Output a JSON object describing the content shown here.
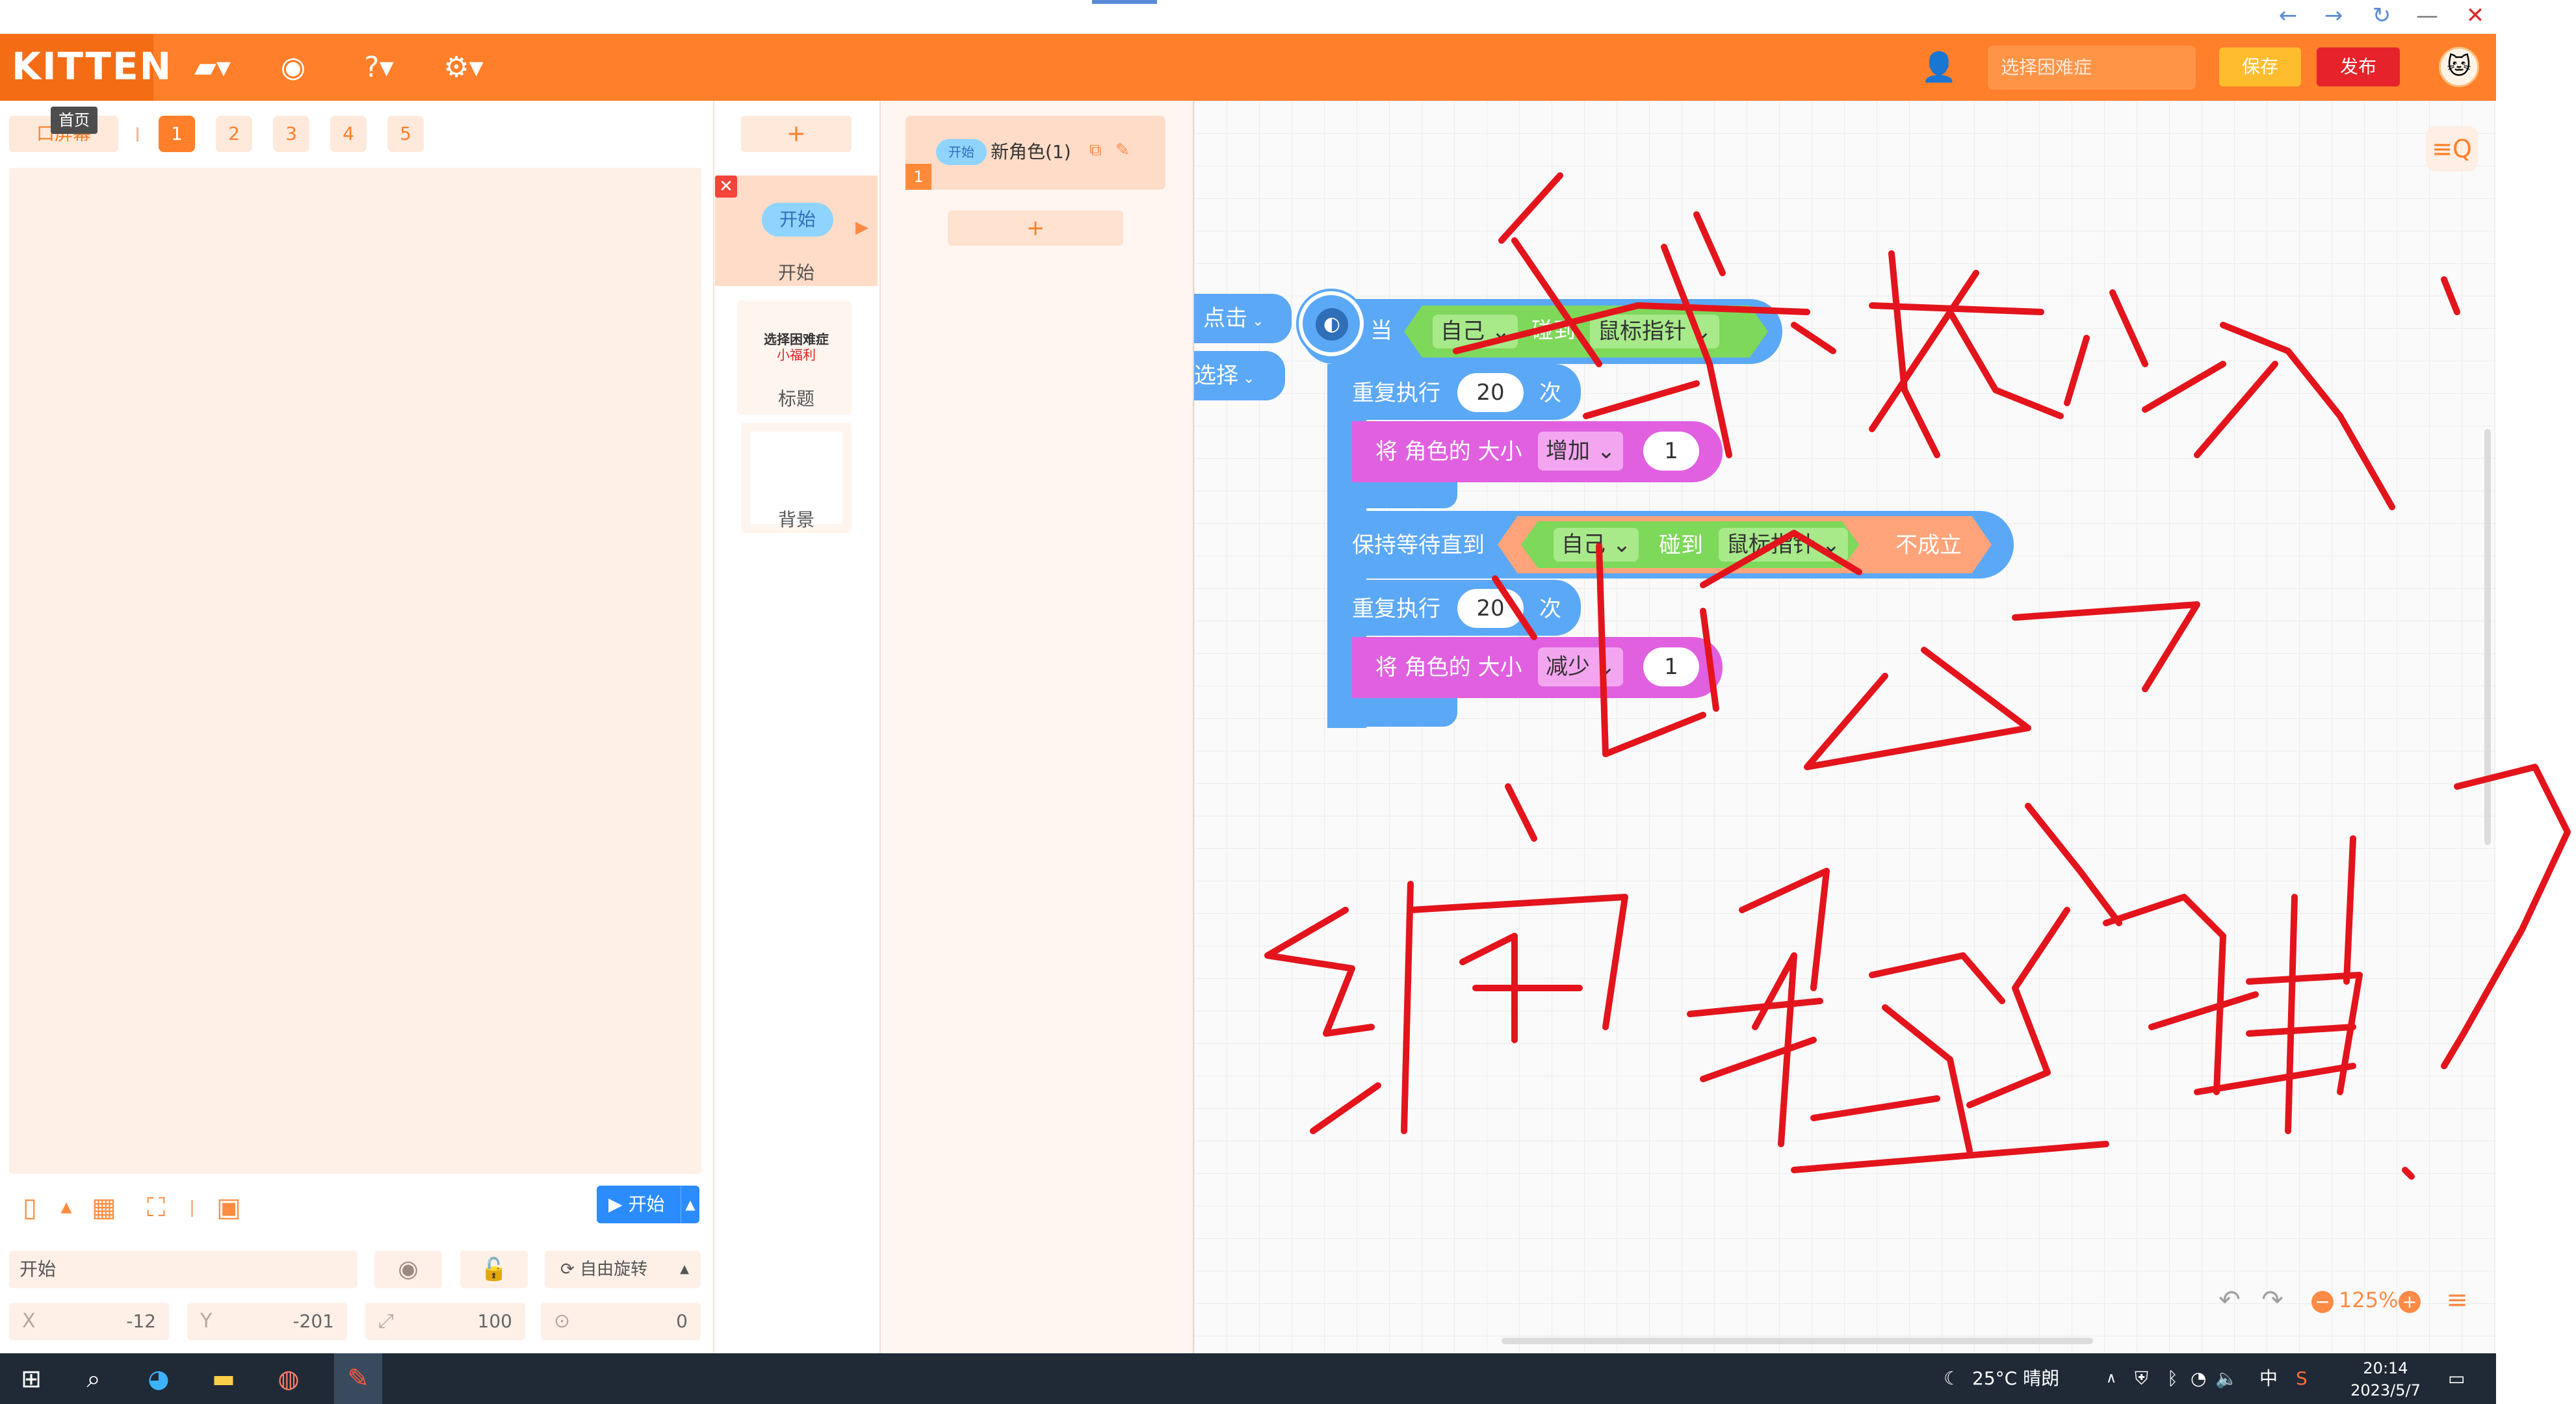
{
  "app": {
    "logo": "KITTEN"
  },
  "topbar": {
    "icons": [
      "folder-icon",
      "backpack-icon",
      "help-icon",
      "settings-icon"
    ],
    "search_placeholder": "选择困难症",
    "save_label": "保存",
    "publish_label": "发布"
  },
  "stage": {
    "fullscreen_label": "口屏幕",
    "tooltip": "首页",
    "pages": [
      "1",
      "2",
      "3",
      "4",
      "5"
    ],
    "run_label": "开始",
    "sprite_name_value": "开始",
    "rotation_label": "自由旋转",
    "x_label": "X",
    "x_value": "-12",
    "y_label": "Y",
    "y_value": "-201",
    "size_value": "100",
    "direction_value": "0"
  },
  "scenes": {
    "add_label": "+",
    "items": [
      {
        "thumb_text": "开始",
        "label": "开始"
      },
      {
        "thumb_title": "选择困难症",
        "thumb_sub": "小福利",
        "label": "标题"
      },
      {
        "label": "背景"
      }
    ]
  },
  "sprites": {
    "add_label": "+",
    "items": [
      {
        "index": "1",
        "tag": "开始",
        "name": "新角色(1)"
      }
    ]
  },
  "blocks": {
    "hat_left_1": "点击",
    "hat_left_2": "选择",
    "when": "当",
    "self": "自己",
    "touch": "碰到",
    "mouse": "鼠标指针",
    "repeat": "重复执行",
    "times": "次",
    "repeat_count_1": "20",
    "repeat_count_2": "20",
    "set_size": "将 角色的 大小",
    "increase": "增加",
    "decrease": "减少",
    "amount_1": "1",
    "amount_2": "1",
    "wait_until": "保持等待直到",
    "not_true": "不成立"
  },
  "workspace": {
    "zoom": "125%"
  },
  "taskbar": {
    "weather": "25°C 晴朗",
    "ime": "中",
    "time": "20:14",
    "date": "2023/5/7"
  },
  "colors": {
    "brand": "#ff7f2a",
    "publish": "#e6232b",
    "save": "#ffbd2e",
    "control_block": "#5ba8f6",
    "looks_block": "#e060e0",
    "sensing_block": "#7ed85a",
    "ink": "#e3141c"
  }
}
